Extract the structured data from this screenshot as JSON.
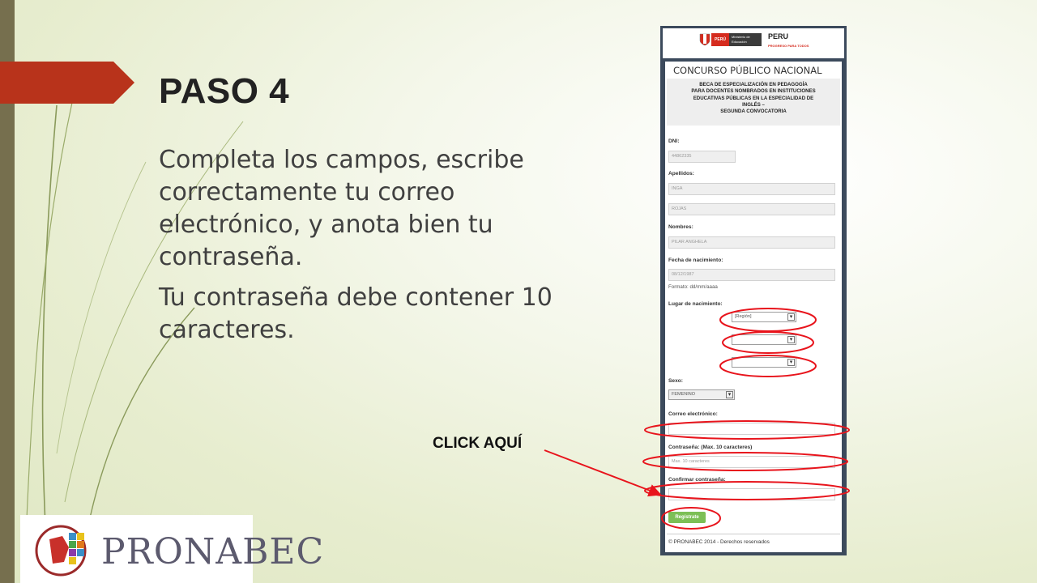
{
  "slide": {
    "title": "PASO 4",
    "paragraph1": "Completa los campos, escribe correctamente tu correo electrónico, y anota bien tu contraseña.",
    "paragraph2": "Tu contraseña debe contener 10 caracteres.",
    "click_label": "CLICK AQUÍ",
    "logo_text": "PRONABEC"
  },
  "form": {
    "header": {
      "peru": "PERÚ",
      "ministerio": "Ministerio de Educación",
      "peru2": "PERU",
      "peru2_tagline": "PROGRESO PARA TODOS"
    },
    "title": "CONCURSO PÚBLICO NACIONAL",
    "subtitle_lines": [
      "BECA DE ESPECIALIZACIÓN EN PEDAGOGÍA",
      "PARA DOCENTES NOMBRADOS EN INSTITUCIONES",
      "EDUCATIVAS PÚBLICAS EN LA ESPECIALIDAD DE",
      "INGLÉS –",
      "SEGUNDA CONVOCATORIA"
    ],
    "dni_label": "DNI:",
    "dni_value": "44862335",
    "apellidos_label": "Apellidos:",
    "apellido1": "INGA",
    "apellido2": "ROJAS",
    "nombres_label": "Nombres:",
    "nombres_value": "PILAR ANGHELA",
    "fecha_label": "Fecha de nacimiento:",
    "fecha_value": "08/12/1987",
    "formato": "Formato: dd/mm/aaaa",
    "lugar_label": "Lugar de nacimiento:",
    "region_value": "[Región]",
    "select2_value": "",
    "select3_value": "",
    "sexo_label": "Sexo:",
    "sexo_value": "FEMENINO",
    "correo_label": "Correo electrónico:",
    "correo_value": "",
    "contrasena_label": "Contraseña: (Max. 10 caracteres)",
    "contrasena_placeholder": "Max. 10 caracteres",
    "confirmar_label": "Confirmar contraseña:",
    "confirmar_value": "",
    "register_button": "Regístrate",
    "footer": "© PRONABEC 2014 - Derechos reservados"
  },
  "colors": {
    "annotation": "#e8141c",
    "title_tab": "#b8331b",
    "register_button": "#7cbf56"
  }
}
